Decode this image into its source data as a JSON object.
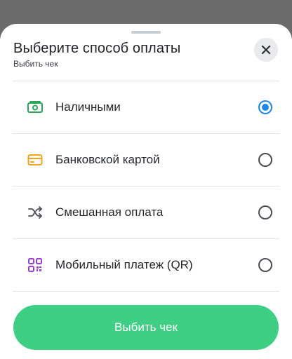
{
  "sheet": {
    "title": "Выберите способ оплаты",
    "subtitle": "Выбить чек"
  },
  "options": [
    {
      "label": "Наличными",
      "icon": "cash-icon",
      "selected": true
    },
    {
      "label": "Банковской картой",
      "icon": "credit-card-icon",
      "selected": false
    },
    {
      "label": "Смешанная оплата",
      "icon": "shuffle-icon",
      "selected": false
    },
    {
      "label": "Мобильный платеж (QR)",
      "icon": "qr-code-icon",
      "selected": false
    }
  ],
  "primary_button": {
    "label": "Выбить чек"
  },
  "colors": {
    "accent_green": "#3ecf84",
    "radio_selected": "#1e88e5",
    "cash_icon": "#2ea65a",
    "card_icon": "#f2a21b",
    "qr_icon": "#9b3fd6"
  }
}
